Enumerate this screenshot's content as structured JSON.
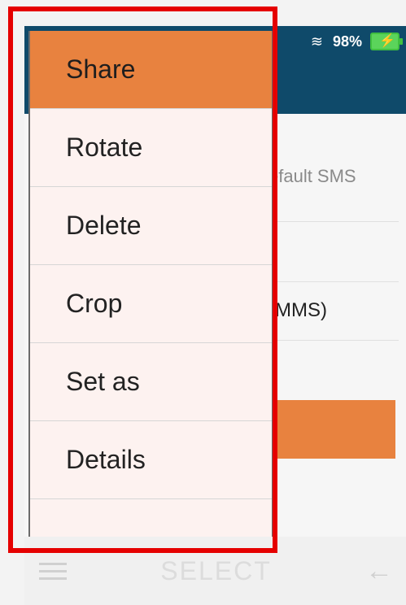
{
  "status_bar": {
    "battery_text": "98%",
    "signal_icon": "signal-icon",
    "battery_icon": "battery-charging-icon"
  },
  "background": {
    "line1_text": "efault SMS",
    "line2_text": "(MMS)"
  },
  "menu": {
    "items": [
      {
        "label": "Share"
      },
      {
        "label": "Rotate"
      },
      {
        "label": "Delete"
      },
      {
        "label": "Crop"
      },
      {
        "label": "Set as"
      },
      {
        "label": "Details"
      },
      {
        "label": ""
      }
    ]
  },
  "bottom_bar": {
    "title": "SELECT",
    "menu_icon": "hamburger-icon",
    "back_icon": "back-arrow-icon"
  },
  "colors": {
    "accent": "#e8823f",
    "header": "#0f4a6a",
    "highlight_border": "#e50000"
  }
}
